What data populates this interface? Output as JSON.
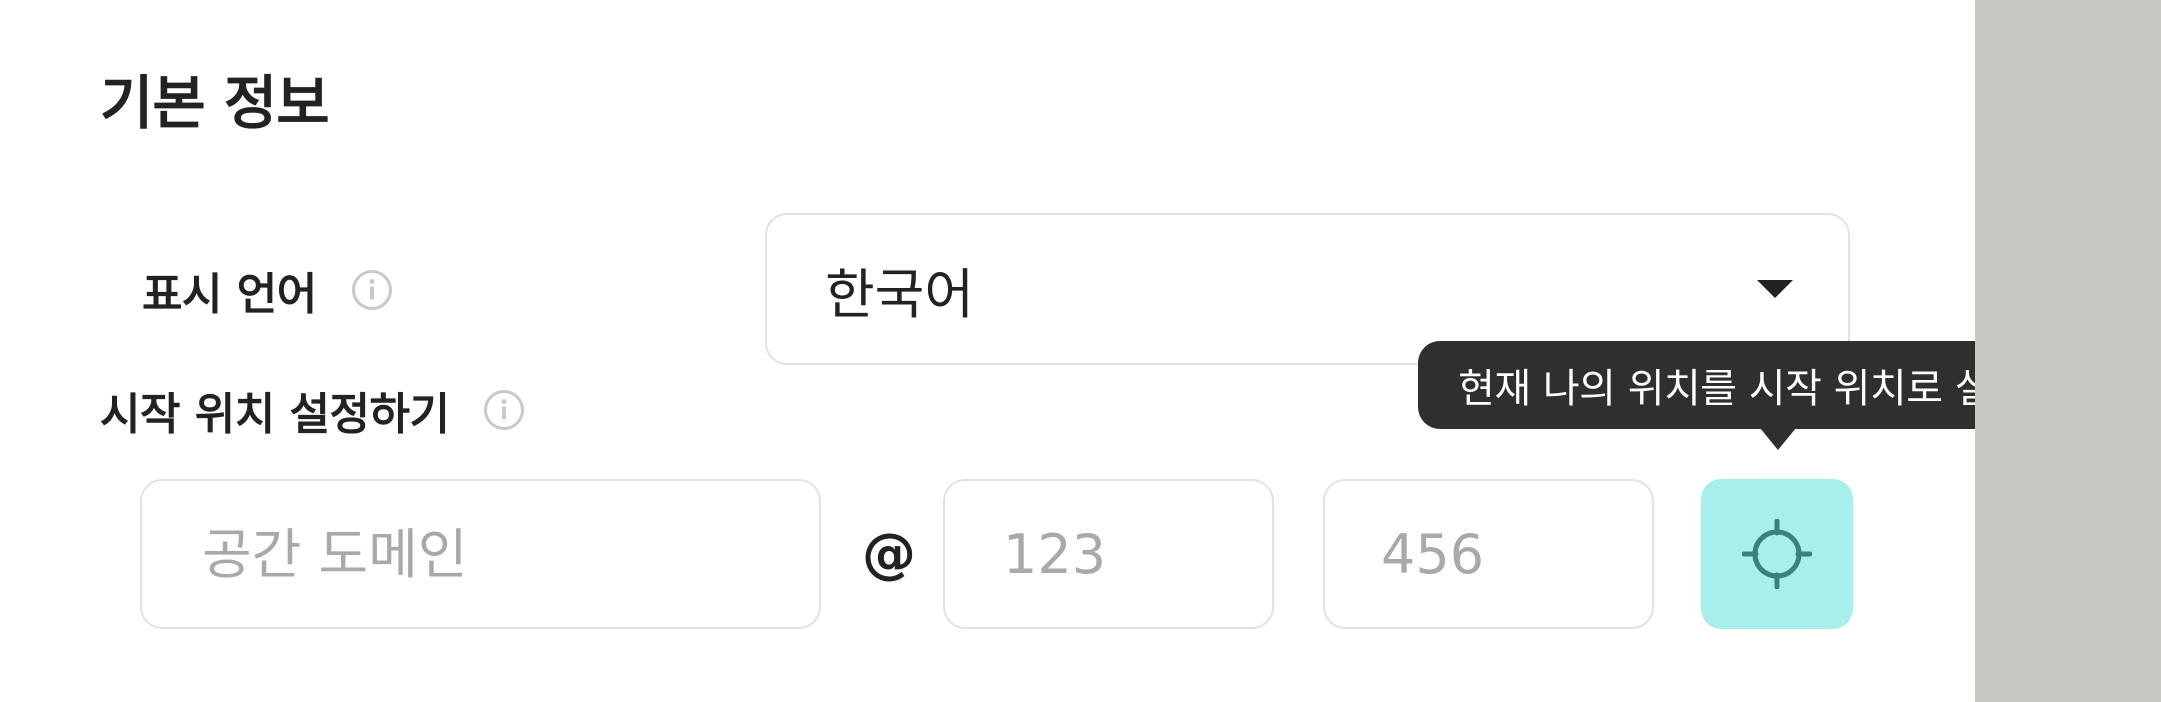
{
  "section": {
    "title": "기본 정보"
  },
  "language": {
    "label": "표시 언어",
    "info_icon": "info-circle-icon",
    "selected_value": "한국어",
    "dropdown_icon": "caret-down-icon"
  },
  "start_location": {
    "label": "시작 위치 설정하기",
    "info_icon": "info-circle-icon",
    "domain_placeholder": "공간 도메인",
    "separator": "@",
    "x_placeholder": "123",
    "y_placeholder": "456",
    "locate_icon": "crosshair-icon",
    "tooltip": "현재 나의 위치를 시작 위치로 설정하기"
  },
  "colors": {
    "accent_button": "#a6efec",
    "accent_icon": "#3d7f7c",
    "tooltip_bg": "#2f2f2f",
    "right_strip": "#c8c7c1",
    "border": "#e2e2e2",
    "placeholder": "#a9a9a9"
  }
}
